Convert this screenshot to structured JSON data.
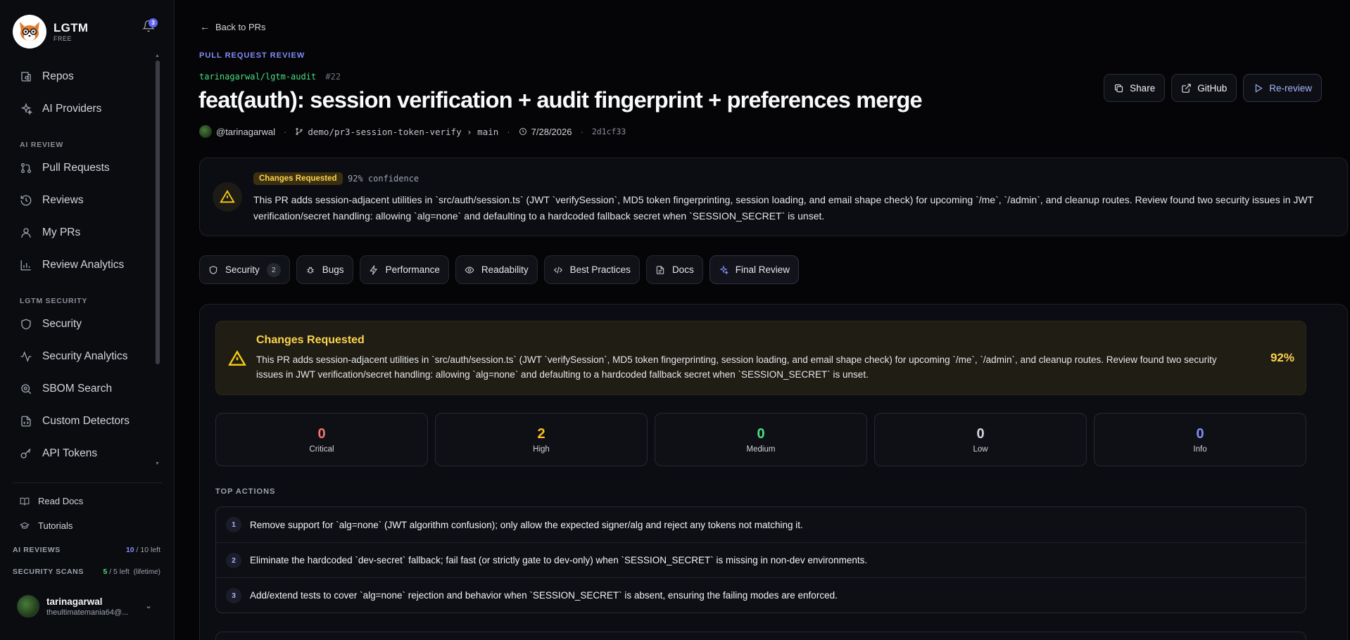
{
  "app": {
    "name": "LGTM",
    "plan": "FREE",
    "notification_count": "3"
  },
  "sidebar": {
    "items_top": [
      {
        "label": "Repos",
        "icon": "repo-icon"
      },
      {
        "label": "AI Providers",
        "icon": "sparkles-icon"
      }
    ],
    "section_ai_review": "AI REVIEW",
    "items_ai_review": [
      {
        "label": "Pull Requests",
        "icon": "git-pull-request-icon"
      },
      {
        "label": "Reviews",
        "icon": "history-icon"
      },
      {
        "label": "My PRs",
        "icon": "user-icon"
      },
      {
        "label": "Review Analytics",
        "icon": "bar-chart-icon"
      }
    ],
    "section_security": "LGTM SECURITY",
    "items_security": [
      {
        "label": "Security",
        "icon": "shield-icon"
      },
      {
        "label": "Security Analytics",
        "icon": "activity-icon"
      },
      {
        "label": "SBOM Search",
        "icon": "search-icon"
      },
      {
        "label": "Custom Detectors",
        "icon": "file-code-icon"
      },
      {
        "label": "API Tokens",
        "icon": "key-icon"
      }
    ],
    "links": [
      {
        "label": "Read Docs",
        "icon": "book-icon"
      },
      {
        "label": "Tutorials",
        "icon": "graduation-cap-icon"
      }
    ],
    "quota_ai": {
      "label": "AI REVIEWS",
      "used": "10",
      "rest": " / 10 left"
    },
    "quota_scans": {
      "label": "SECURITY SCANS",
      "used": "5",
      "rest": " / 5 left",
      "note": "(lifetime)"
    },
    "user": {
      "name": "tarinagarwal",
      "email": "theultimatemania64@..."
    }
  },
  "header": {
    "back_label": "Back to PRs",
    "eyebrow": "PULL REQUEST REVIEW",
    "repo": "tarinagarwal/lgtm-audit",
    "pr_number": "#22",
    "title": "feat(auth): session verification + audit fingerprint + preferences merge",
    "author": "@tarinagarwal",
    "branch": "demo/pr3-session-token-verify › main",
    "date": "7/28/2026",
    "sha": "2d1cf33",
    "buttons": {
      "share": "Share",
      "github": "GitHub",
      "rereview": "Re-review"
    }
  },
  "summary": {
    "status": "Changes Requested",
    "confidence": "92% confidence",
    "text": "This PR adds session-adjacent utilities in `src/auth/session.ts` (JWT `verifySession`, MD5 token fingerprinting, session loading, and email shape check) for upcoming `/me`, `/admin`, and cleanup routes. Review found two security issues in JWT verification/secret handling: allowing `alg=none` and defaulting to a hardcoded fallback secret when `SESSION_SECRET` is unset."
  },
  "tabs": [
    {
      "label": "Security",
      "count": "2",
      "icon": "shield-icon"
    },
    {
      "label": "Bugs",
      "icon": "bug-icon"
    },
    {
      "label": "Performance",
      "icon": "zap-icon"
    },
    {
      "label": "Readability",
      "icon": "eye-icon"
    },
    {
      "label": "Best Practices",
      "icon": "code-icon"
    },
    {
      "label": "Docs",
      "icon": "file-text-icon"
    },
    {
      "label": "Final Review",
      "icon": "sparkles-icon",
      "active": true
    }
  ],
  "final_review": {
    "verdict_title": "Changes Requested",
    "verdict_text": "This PR adds session-adjacent utilities in `src/auth/session.ts` (JWT `verifySession`, MD5 token fingerprinting, session loading, and email shape check) for upcoming `/me`, `/admin`, and cleanup routes. Review found two security issues in JWT verification/secret handling: allowing `alg=none` and defaulting to a hardcoded fallback secret when `SESSION_SECRET` is unset.",
    "verdict_pct": "92%",
    "stats": [
      {
        "value": "0",
        "label": "Critical",
        "color": "#f87171"
      },
      {
        "value": "2",
        "label": "High",
        "color": "#fbbf24"
      },
      {
        "value": "0",
        "label": "Medium",
        "color": "#4ade80"
      },
      {
        "value": "0",
        "label": "Low",
        "color": "#d1d5db"
      },
      {
        "value": "0",
        "label": "Info",
        "color": "#818cf8"
      }
    ],
    "top_actions_label": "TOP ACTIONS",
    "actions": [
      {
        "n": "1",
        "text": "Remove support for `alg=none` (JWT algorithm confusion); only allow the expected signer/alg and reject any tokens not matching it."
      },
      {
        "n": "2",
        "text": "Eliminate the hardcoded `dev-secret` fallback; fail fast (or strictly gate to dev-only) when `SESSION_SECRET` is missing in non-dev environments."
      },
      {
        "n": "3",
        "text": "Add/extend tests to cover `alg=none` rejection and behavior when `SESSION_SECRET` is absent, ensuring the failing modes are enforced."
      }
    ]
  }
}
